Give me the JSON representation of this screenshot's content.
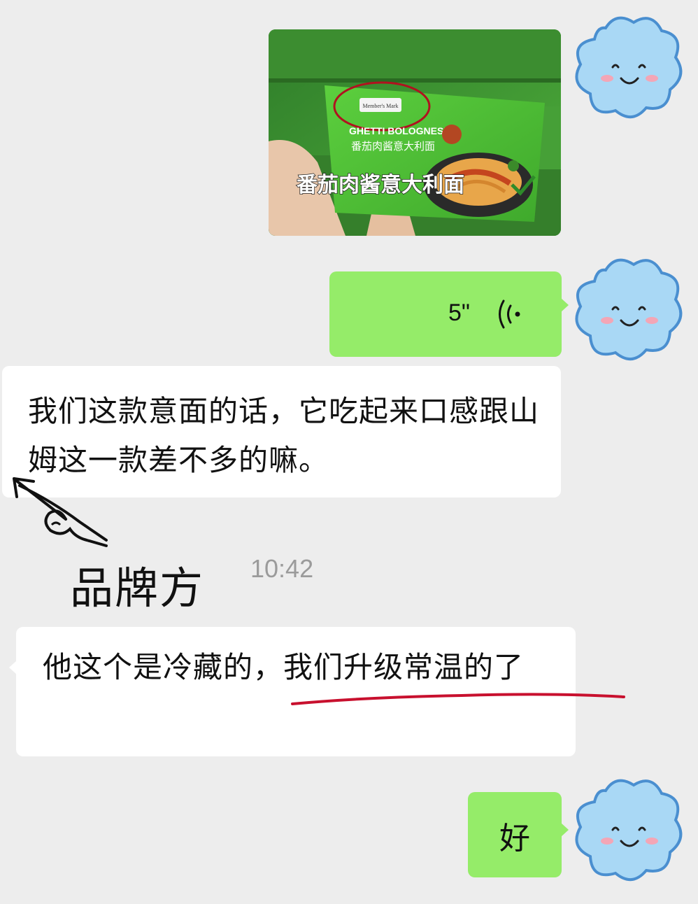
{
  "chat": {
    "image_message": {
      "product_banner": "番茄肉酱意大利面",
      "package_subtitle": "GHETTI BOLOGNESE",
      "package_name": "番茄肉酱意大利面",
      "package_brand": "Member's Mark"
    },
    "voice_message": {
      "duration": "5\"",
      "icon": "voice-wave-icon"
    },
    "messages": [
      {
        "side": "left",
        "text": "我们这款意面的话，它吃起来口感跟山姆这一款差不多的嘛。"
      },
      {
        "side": "left",
        "text": "他这个是冷藏的，我们升级常温的了"
      },
      {
        "side": "right",
        "text": "好"
      }
    ],
    "timestamp": "10:42",
    "annotation_label": "品牌方"
  },
  "avatar": {
    "icon": "smiling-cloud-icon",
    "colors": {
      "fill": "#a9d8f5",
      "outline": "#4a8fd0",
      "cheek": "#f3a6b6"
    }
  },
  "colors": {
    "background": "#ededed",
    "bubble_me": "#95ec69",
    "bubble_other": "#ffffff",
    "timestamp": "#9b9b9b",
    "underline": "#c8102e"
  }
}
